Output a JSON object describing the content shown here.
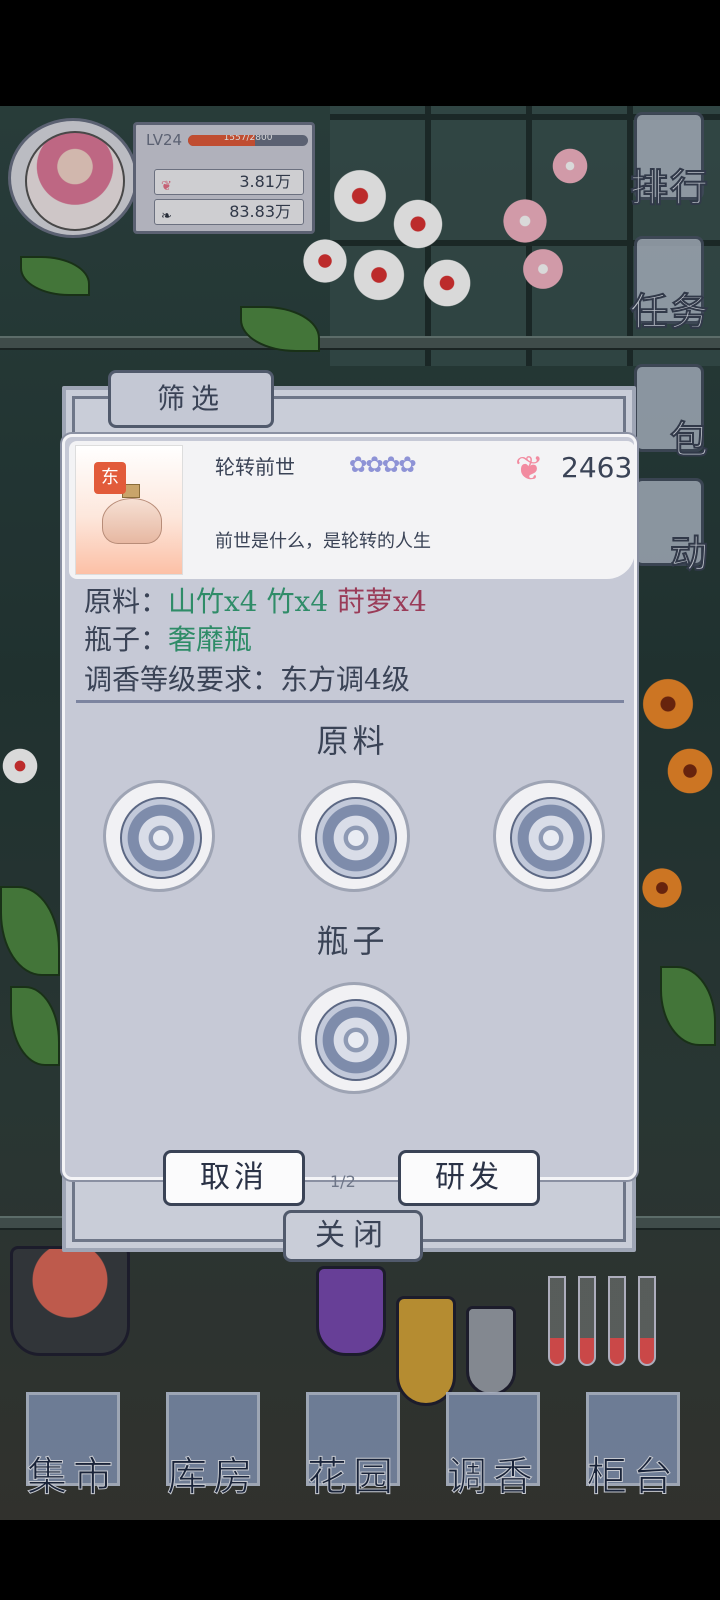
{
  "player": {
    "level": "LV24",
    "xp_text": "1557/2800",
    "xp_fraction": 0.56,
    "petals": "3.81万",
    "leaves": "83.83万"
  },
  "side_menu": [
    "排行",
    "任务",
    "包",
    "动"
  ],
  "dialog": {
    "filter_tab": "筛选",
    "product": {
      "tag": "东",
      "name": "轮转前世",
      "stars": "✿✿✿✿",
      "price": "2463",
      "description": "前世是什么，是轮转的人生"
    },
    "ingredients_label": "原料：",
    "ingredients": [
      {
        "text": "山竹x4",
        "color": "#2f8c68"
      },
      {
        "text": "竹x4",
        "color": "#2f8c68"
      },
      {
        "text": "莳萝x4",
        "color": "#9a3b58"
      }
    ],
    "bottle_label": "瓶子：",
    "bottle_value": "奢靡瓶",
    "requirement": "调香等级要求：东方调4级",
    "section_materials": "原料",
    "section_bottle": "瓶子",
    "cancel_button": "取消",
    "develop_button": "研发",
    "page_indicator": "1/2",
    "close_button": "关闭"
  },
  "bottom_nav": [
    "集市",
    "库房",
    "花园",
    "调香",
    "柜台"
  ]
}
